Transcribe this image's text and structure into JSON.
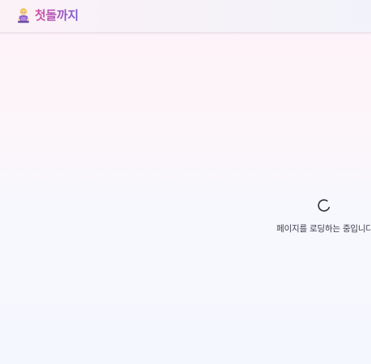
{
  "header": {
    "title": "첫돌까지",
    "logo_icon": "baby-crawling-icon"
  },
  "loading": {
    "icon": "spinner-icon",
    "message": "페이지를 로딩하는 중입니다.."
  },
  "colors": {
    "brand_gradient_start": "#d64ba0",
    "brand_gradient_end": "#7c5cd6",
    "spinner": "#2b2b35",
    "text": "#3b3b4a"
  }
}
